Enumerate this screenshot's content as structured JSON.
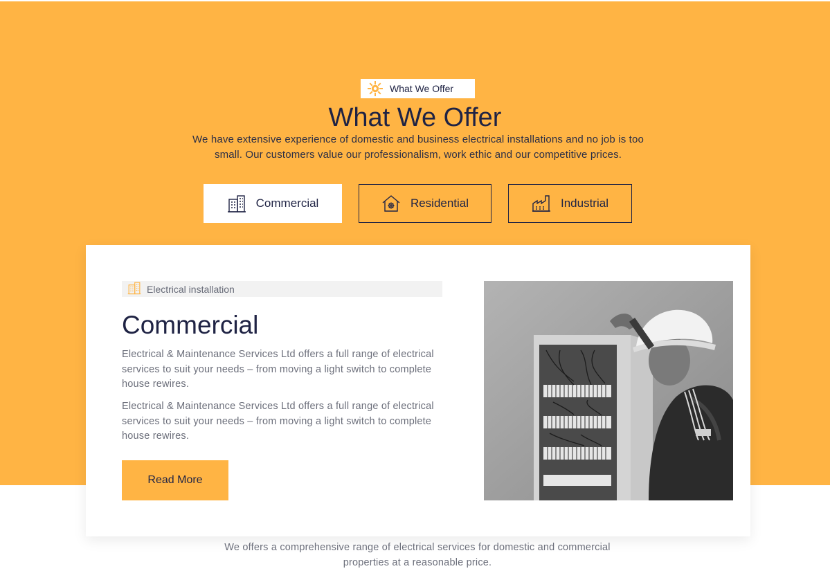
{
  "colors": {
    "accent": "#ffb444",
    "heading": "#1f2344",
    "body_text": "#6b6e7a",
    "white": "#ffffff"
  },
  "section": {
    "badge_label": "What We Offer",
    "badge_icon": "sun-gear-icon",
    "title": "What We Offer",
    "intro": "We have extensive experience of domestic and business electrical installations and no job is too small. Our customers value our professionalism, work ethic and our competitive prices."
  },
  "tabs": [
    {
      "label": "Commercial",
      "icon": "office-building-icon",
      "active": true
    },
    {
      "label": "Residential",
      "icon": "house-gear-icon",
      "active": false
    },
    {
      "label": "Industrial",
      "icon": "factory-icon",
      "active": false
    }
  ],
  "card": {
    "tag_label": "Electrical installation",
    "tag_icon": "office-building-icon",
    "title": "Commercial",
    "paragraphs": [
      "Electrical & Maintenance Services Ltd offers a full range of electrical services to suit your needs – from moving a light switch to complete house rewires.",
      "Electrical & Maintenance Services Ltd offers a full range of electrical services to suit your needs – from moving a light switch to complete house rewires."
    ],
    "button_label": "Read More",
    "image_alt": "electrician-at-fuse-box-photo"
  },
  "footer": {
    "text": "We offers a comprehensive range of electrical services for domestic and commercial properties at a reasonable price."
  }
}
